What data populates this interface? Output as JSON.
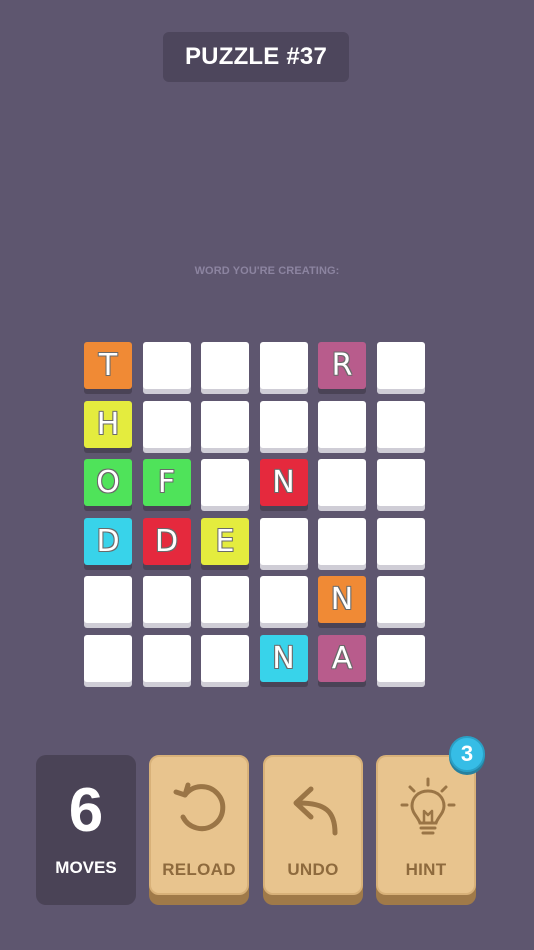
{
  "header": {
    "title": "PUZZLE #37"
  },
  "word_label": "WORD YOU'RE CREATING:",
  "board": {
    "rows": [
      [
        {
          "letter": "T",
          "color": "#f08a35"
        },
        {
          "letter": "",
          "color": ""
        },
        {
          "letter": "",
          "color": ""
        },
        {
          "letter": "",
          "color": ""
        },
        {
          "letter": "R",
          "color": "#b85c8c"
        },
        {
          "letter": "",
          "color": ""
        }
      ],
      [
        {
          "letter": "H",
          "color": "#e4ec3e"
        },
        {
          "letter": "",
          "color": ""
        },
        {
          "letter": "",
          "color": ""
        },
        {
          "letter": "",
          "color": ""
        },
        {
          "letter": "",
          "color": ""
        },
        {
          "letter": "",
          "color": ""
        }
      ],
      [
        {
          "letter": "O",
          "color": "#4fe35a"
        },
        {
          "letter": "F",
          "color": "#4fe35a"
        },
        {
          "letter": "",
          "color": ""
        },
        {
          "letter": "N",
          "color": "#e5293d"
        },
        {
          "letter": "",
          "color": ""
        },
        {
          "letter": "",
          "color": ""
        }
      ],
      [
        {
          "letter": "D",
          "color": "#38d3ea"
        },
        {
          "letter": "D",
          "color": "#e5293d"
        },
        {
          "letter": "E",
          "color": "#e4ec3e"
        },
        {
          "letter": "",
          "color": ""
        },
        {
          "letter": "",
          "color": ""
        },
        {
          "letter": "",
          "color": ""
        }
      ],
      [
        {
          "letter": "",
          "color": ""
        },
        {
          "letter": "",
          "color": ""
        },
        {
          "letter": "",
          "color": ""
        },
        {
          "letter": "",
          "color": ""
        },
        {
          "letter": "N",
          "color": "#f08a35"
        },
        {
          "letter": "",
          "color": ""
        }
      ],
      [
        {
          "letter": "",
          "color": ""
        },
        {
          "letter": "",
          "color": ""
        },
        {
          "letter": "",
          "color": ""
        },
        {
          "letter": "N",
          "color": "#38d3ea"
        },
        {
          "letter": "A",
          "color": "#b85c8c"
        },
        {
          "letter": "",
          "color": ""
        }
      ]
    ]
  },
  "moves": {
    "count": "6",
    "label": "MOVES"
  },
  "buttons": {
    "reload": {
      "label": "RELOAD",
      "icon": "reload-icon"
    },
    "undo": {
      "label": "UNDO",
      "icon": "undo-icon"
    },
    "hint": {
      "label": "HINT",
      "icon": "lightbulb-icon",
      "badge": "3"
    }
  }
}
